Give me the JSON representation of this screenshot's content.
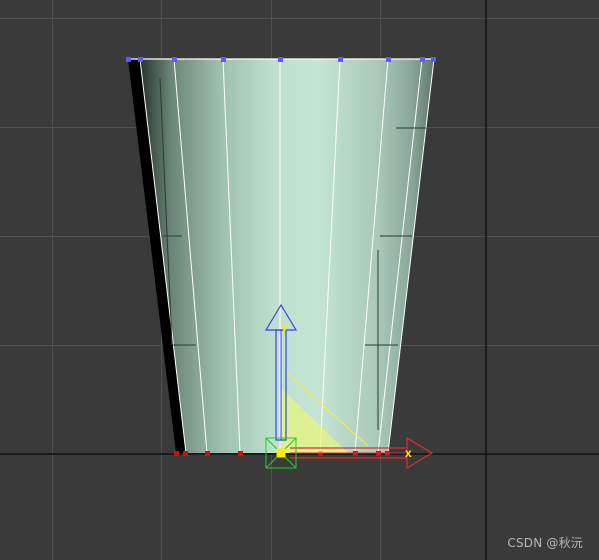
{
  "viewport": {
    "background": "#3a3a3a",
    "grid_color": "#505050",
    "world_axis_color": "#111111"
  },
  "mesh": {
    "type": "truncated-cone",
    "fill_color": "#c2e2d2",
    "edge_color": "#ffffff",
    "selected_vertex_color": "#5a5aff",
    "bottom_vertex_color": "#cc1111"
  },
  "gizmo": {
    "x_label": "x",
    "y_label": "y",
    "x_color": "#d83030",
    "y_color": "#3344ee",
    "plane_color": "#e8f57a",
    "label_color": "#ffee00",
    "center_color": "#22cc22"
  },
  "watermark": {
    "text": "CSDN @秋沅"
  }
}
